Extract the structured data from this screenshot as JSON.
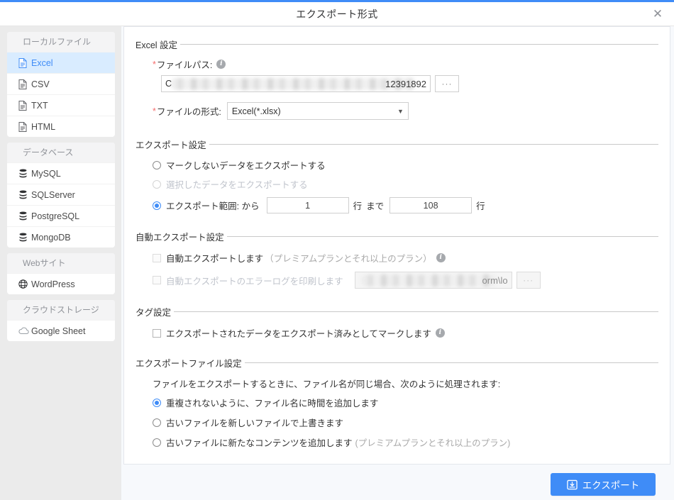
{
  "window": {
    "title": "エクスポート形式",
    "close_label": "✕",
    "accent_color": "#3f8cf7"
  },
  "sidebar": {
    "groups": [
      {
        "title": "ローカルファイル",
        "items": [
          {
            "label": "Excel",
            "icon": "file-icon",
            "active": true
          },
          {
            "label": "CSV",
            "icon": "file-icon",
            "active": false
          },
          {
            "label": "TXT",
            "icon": "file-icon",
            "active": false
          },
          {
            "label": "HTML",
            "icon": "file-icon",
            "active": false
          }
        ]
      },
      {
        "title": "データベース",
        "items": [
          {
            "label": "MySQL",
            "icon": "database-icon",
            "active": false
          },
          {
            "label": "SQLServer",
            "icon": "database-icon",
            "active": false
          },
          {
            "label": "PostgreSQL",
            "icon": "database-icon",
            "active": false
          },
          {
            "label": "MongoDB",
            "icon": "database-icon",
            "active": false
          }
        ]
      },
      {
        "title": "Webサイト",
        "items": [
          {
            "label": "WordPress",
            "icon": "globe-icon",
            "active": false
          }
        ]
      },
      {
        "title": "クラウドストレージ",
        "items": [
          {
            "label": "Google Sheet",
            "icon": "cloud-icon",
            "active": false
          }
        ]
      }
    ]
  },
  "excel_settings": {
    "legend": "Excel 設定",
    "file_path": {
      "required_mark": "*",
      "label": "ファイルパス:",
      "info_icon": "info-icon",
      "value_prefix": "C",
      "value_suffix": "12391892",
      "browse_label": "···"
    },
    "file_format": {
      "required_mark": "*",
      "label": "ファイルの形式:",
      "selected": "Excel(*.xlsx)",
      "caret": "▼"
    }
  },
  "export_settings": {
    "legend": "エクスポート設定",
    "option_unmarked": "マークしないデータをエクスポートする",
    "option_selected_data": "選択したデータをエクスポートする",
    "option_range_label": "エクスポート範囲: から",
    "range_from": "1",
    "unit_row_1": "行",
    "until_label": "まで",
    "range_to": "108",
    "unit_row_2": "行"
  },
  "auto_export": {
    "legend": "自動エクスポート設定",
    "auto_export_label": "自動エクスポートします",
    "auto_export_plan": "（プレミアムプランとそれ以上のプラン）",
    "info_icon": "info-icon",
    "error_log_label": "自動エクスポートのエラーログを印刷します",
    "error_log_path_suffix": "orm\\lo",
    "browse_label": "···"
  },
  "tag_settings": {
    "legend": "タグ設定",
    "mark_exported_label": "エクスポートされたデータをエクスポート済みとしてマークします",
    "info_icon": "info-icon"
  },
  "export_file_settings": {
    "legend": "エクスポートファイル設定",
    "description": "ファイルをエクスポートするときに、ファイル名が同じ場合、次のように処理されます:",
    "option_add_time": "重複されないように、ファイル名に時間を追加します",
    "option_overwrite": "古いファイルを新しいファイルで上書きます",
    "option_append": "古いファイルに新たなコンテンツを追加します",
    "option_append_plan": "(プレミアムプランとそれ以上のプラン)"
  },
  "footer": {
    "export_button": "エクスポート",
    "export_icon": "save-download-icon"
  }
}
